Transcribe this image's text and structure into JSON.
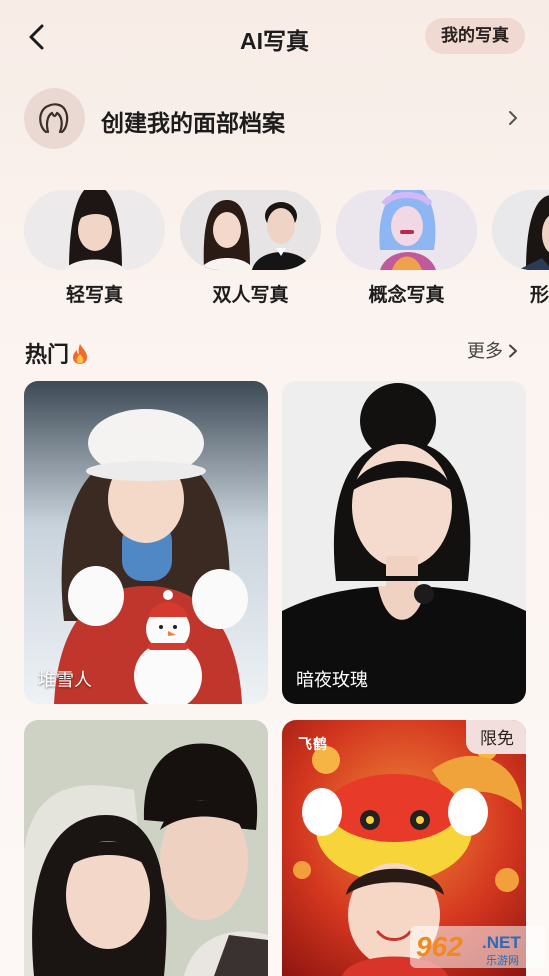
{
  "header": {
    "title": "AI写真",
    "my_photos_button": "我的写真",
    "back_icon": "chevron-left-icon"
  },
  "face_profile": {
    "label": "创建我的面部档案",
    "icon": "face-profile-icon",
    "arrow_icon": "chevron-right-icon"
  },
  "categories": [
    {
      "label": "轻写真"
    },
    {
      "label": "双人写真"
    },
    {
      "label": "概念写真"
    },
    {
      "label": "形"
    }
  ],
  "hot": {
    "title": "热门",
    "icon": "fire-icon",
    "more_label": "更多"
  },
  "cards": [
    {
      "label": "堆雪人",
      "badge": "",
      "brand": ""
    },
    {
      "label": "暗夜玫瑰",
      "badge": "",
      "brand": ""
    },
    {
      "label": "",
      "badge": "",
      "brand": ""
    },
    {
      "label": "",
      "badge": "限免",
      "brand": "飞鹤"
    }
  ],
  "watermark": {
    "text_num": "962",
    "text_net": ".NET",
    "text_cn": "乐游网"
  },
  "colors": {
    "accent_pill": "#f0d9d0",
    "icon_circle": "#ead9d2",
    "background": "#f9efea"
  }
}
